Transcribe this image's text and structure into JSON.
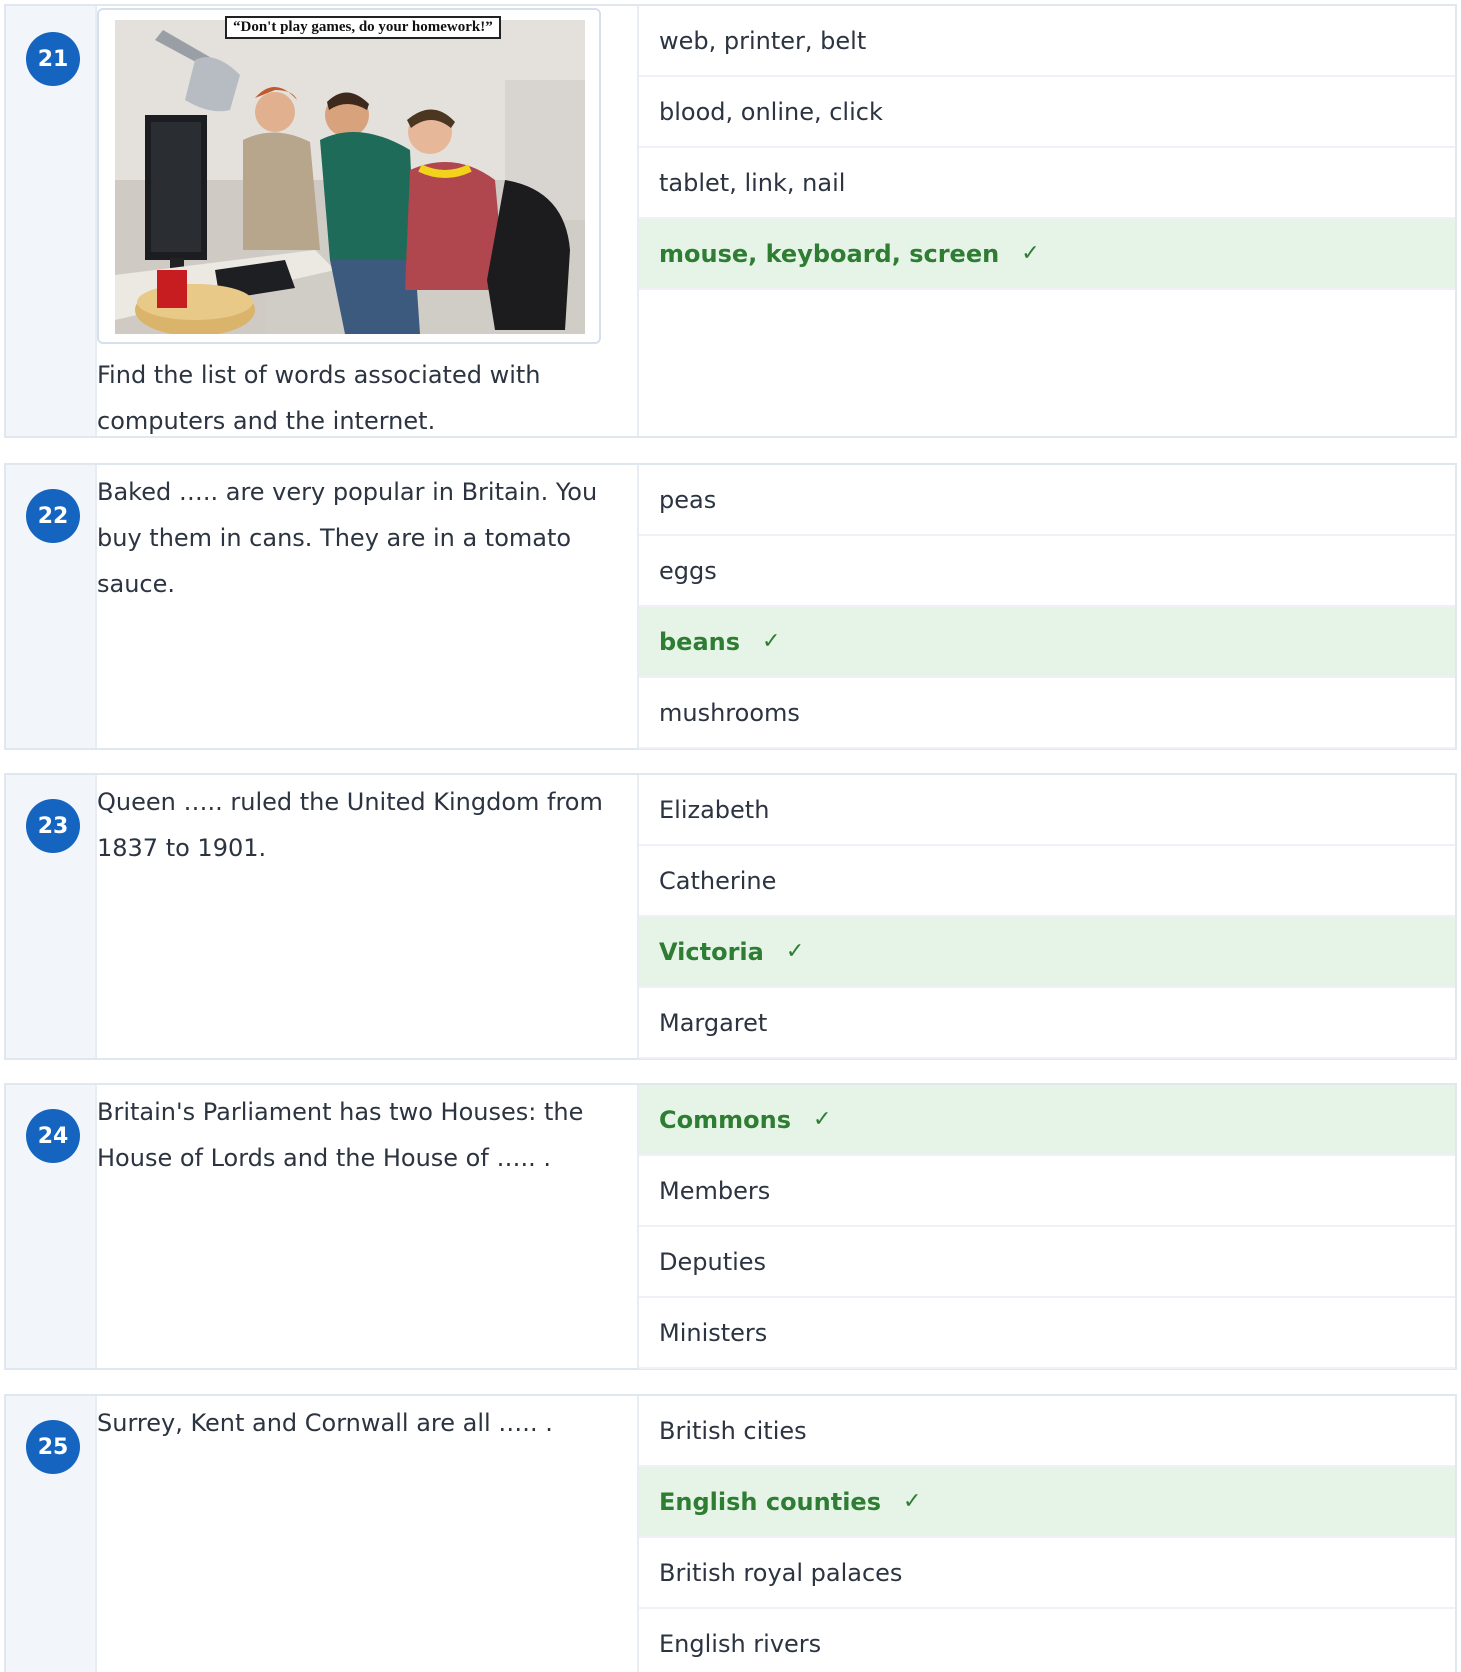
{
  "questions": [
    {
      "number": "21",
      "image_caption": "“Don't play games, do your homework!”",
      "prompt": "Find the list of words associated with computers and the internet.",
      "options": [
        {
          "label": "web, printer, belt",
          "correct": false
        },
        {
          "label": "blood, online, click",
          "correct": false
        },
        {
          "label": "tablet, link, nail",
          "correct": false
        },
        {
          "label": "mouse, keyboard, screen",
          "correct": true
        }
      ]
    },
    {
      "number": "22",
      "prompt": "Baked ….. are very popular in Britain. You buy them in cans. They are in a tomato sauce.",
      "options": [
        {
          "label": "peas",
          "correct": false
        },
        {
          "label": "eggs",
          "correct": false
        },
        {
          "label": "beans",
          "correct": true
        },
        {
          "label": "mushrooms",
          "correct": false
        }
      ]
    },
    {
      "number": "23",
      "prompt": "Queen ….. ruled the United Kingdom from 1837 to 1901.",
      "options": [
        {
          "label": "Elizabeth",
          "correct": false
        },
        {
          "label": "Catherine",
          "correct": false
        },
        {
          "label": "Victoria",
          "correct": true
        },
        {
          "label": "Margaret",
          "correct": false
        }
      ]
    },
    {
      "number": "24",
      "prompt": "Britain's Parliament has two Houses: the House of Lords and the House of ….. .",
      "options": [
        {
          "label": "Commons",
          "correct": true
        },
        {
          "label": "Members",
          "correct": false
        },
        {
          "label": "Deputies",
          "correct": false
        },
        {
          "label": "Ministers",
          "correct": false
        }
      ]
    },
    {
      "number": "25",
      "prompt": "Surrey, Kent and Cornwall are all ….. .",
      "options": [
        {
          "label": "British cities",
          "correct": false
        },
        {
          "label": "English counties",
          "correct": true
        },
        {
          "label": "British royal palaces",
          "correct": false
        },
        {
          "label": "English rivers",
          "correct": false
        }
      ]
    }
  ],
  "check_mark": "✓",
  "colors": {
    "badge": "#1565c0",
    "correct_bg": "#e6f4e8",
    "correct_text": "#2e7d32",
    "number_column_bg": "#f2f6fa",
    "border": "#e1e7ee"
  }
}
